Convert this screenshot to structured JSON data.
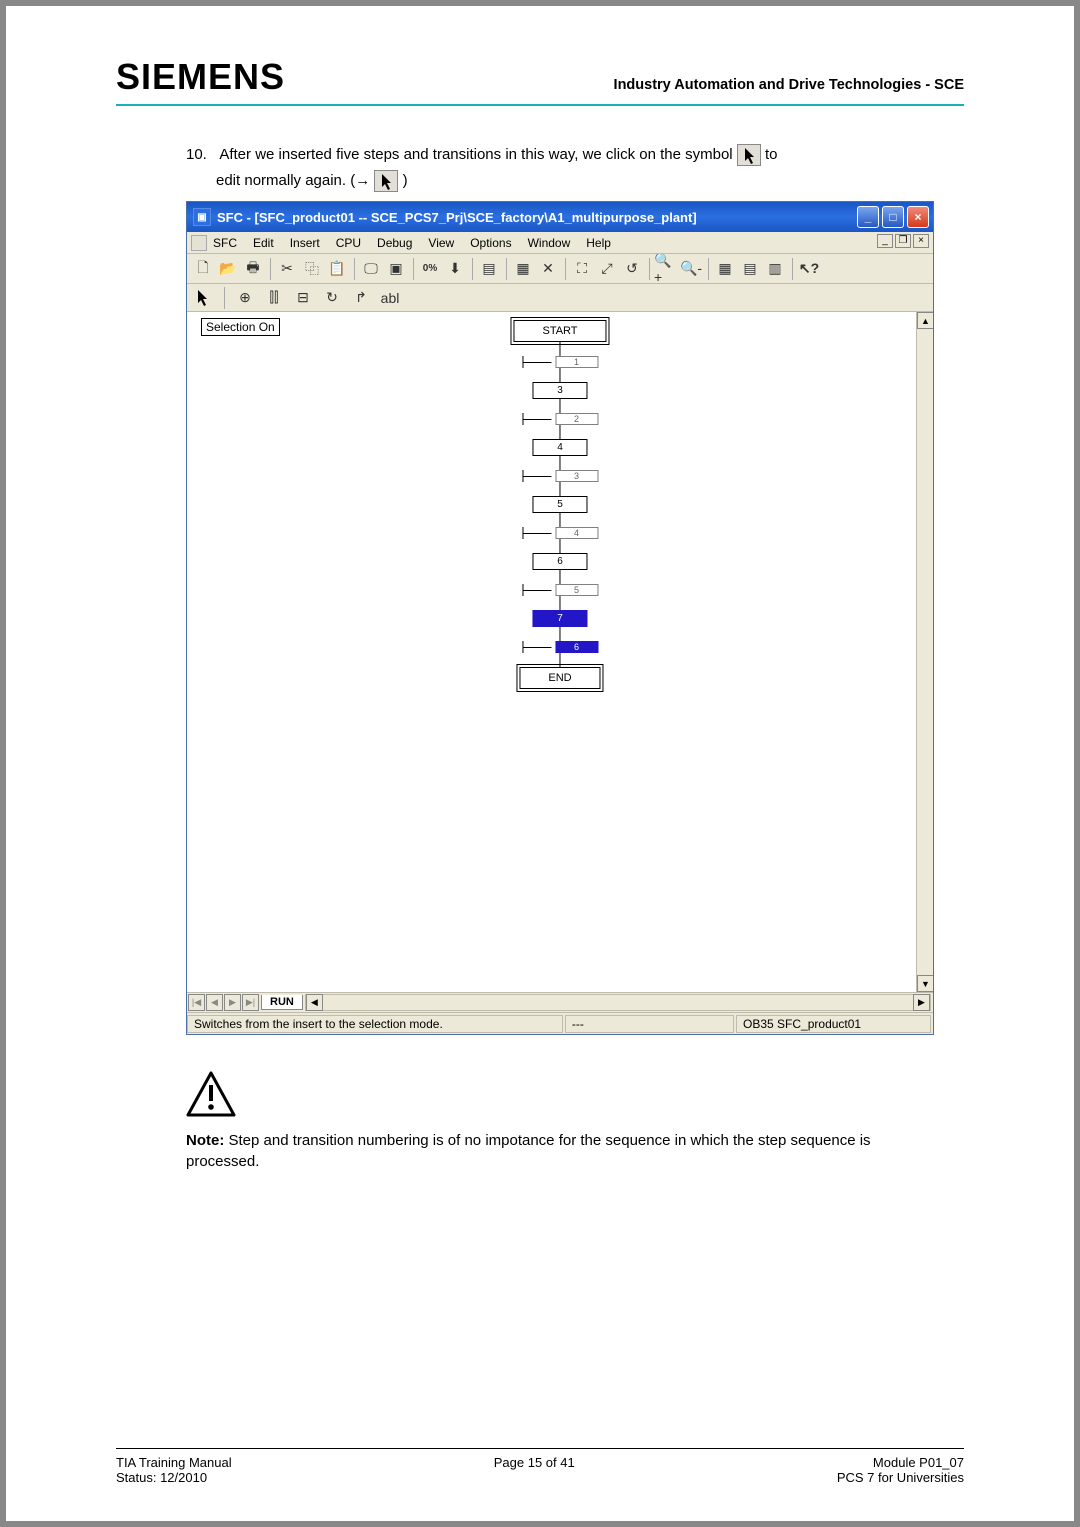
{
  "header": {
    "logo": "SIEMENS",
    "right": "Industry Automation and Drive Technologies - SCE"
  },
  "instruction": {
    "number": "10.",
    "line1a": "After we inserted five steps and transitions in this way, we click on the symbol ",
    "line1b": " to",
    "line2a": "edit normally again. (→ ",
    "line2b": ")"
  },
  "window": {
    "title": "SFC - [SFC_product01 -- SCE_PCS7_Prj\\SCE_factory\\A1_multipurpose_plant]",
    "menu": [
      "SFC",
      "Edit",
      "Insert",
      "CPU",
      "Debug",
      "View",
      "Options",
      "Window",
      "Help"
    ],
    "toolbar2_abl": "abl",
    "selection_on": "Selection On",
    "steps": {
      "start": "START",
      "s3": "3",
      "s4": "4",
      "s5": "5",
      "s6": "6",
      "s7": "7",
      "end": "END"
    },
    "transitions": {
      "t1": "1",
      "t2": "2",
      "t3": "3",
      "t4": "4",
      "t5": "5",
      "t6": "6"
    },
    "sheet_tab": "RUN",
    "status_left": "Switches from the insert to the selection mode.",
    "status_mid": "---",
    "status_right": "OB35  SFC_product01"
  },
  "note": {
    "label": "Note:",
    "text": " Step and transition numbering is of no impotance for the sequence in which the step sequence is processed."
  },
  "footer": {
    "left1": "TIA Training Manual",
    "left2": "Status: 12/2010",
    "center": "Page 15 of 41",
    "right1": "Module P01_07",
    "right2": "PCS 7 for Universities"
  }
}
